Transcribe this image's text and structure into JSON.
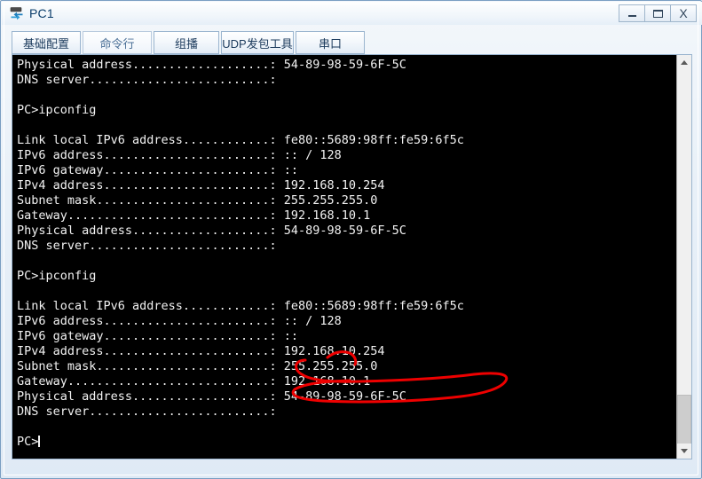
{
  "window": {
    "title": "PC1",
    "icon": "pc-device-icon",
    "controls": {
      "minimize": "minimize-icon",
      "maximize": "maximize-icon",
      "close": "X"
    }
  },
  "tabs": [
    {
      "label": "基础配置",
      "active": false,
      "name": "tab-basic-config"
    },
    {
      "label": "命令行",
      "active": true,
      "name": "tab-command-line"
    },
    {
      "label": "组播",
      "active": false,
      "name": "tab-multicast"
    },
    {
      "label": "UDP发包工具",
      "active": false,
      "name": "tab-udp-tool"
    },
    {
      "label": "串口",
      "active": false,
      "name": "tab-serial-port"
    }
  ],
  "terminal": {
    "background": "#000000",
    "foreground": "#f2f2f2",
    "prompt": "PC>",
    "lines": [
      "Physical address...................: 54-89-98-59-6F-5C",
      "DNS server.........................:",
      "",
      "PC>ipconfig",
      "",
      "Link local IPv6 address............: fe80::5689:98ff:fe59:6f5c",
      "IPv6 address.......................: :: / 128",
      "IPv6 gateway.......................: ::",
      "IPv4 address.......................: 192.168.10.254",
      "Subnet mask........................: 255.255.255.0",
      "Gateway............................: 192.168.10.1",
      "Physical address...................: 54-89-98-59-6F-5C",
      "DNS server.........................:",
      "",
      "PC>ipconfig",
      "",
      "Link local IPv6 address............: fe80::5689:98ff:fe59:6f5c",
      "IPv6 address.......................: :: / 128",
      "IPv6 gateway.......................: ::",
      "IPv4 address.......................: 192.168.10.254",
      "Subnet mask........................: 255.255.255.0",
      "Gateway............................: 192.168.10.1",
      "Physical address...................: 54-89-98-59-6F-5C",
      "DNS server.........................:",
      "",
      "PC>"
    ]
  },
  "annotation": {
    "color": "#ee0000",
    "shape": "hand-drawn-ellipse",
    "encircles": "192.168.10.254"
  },
  "scrollbar": {
    "up_arrow": "chevron-up-icon",
    "down_arrow": "chevron-down-icon",
    "thumb_position": "near-bottom"
  }
}
